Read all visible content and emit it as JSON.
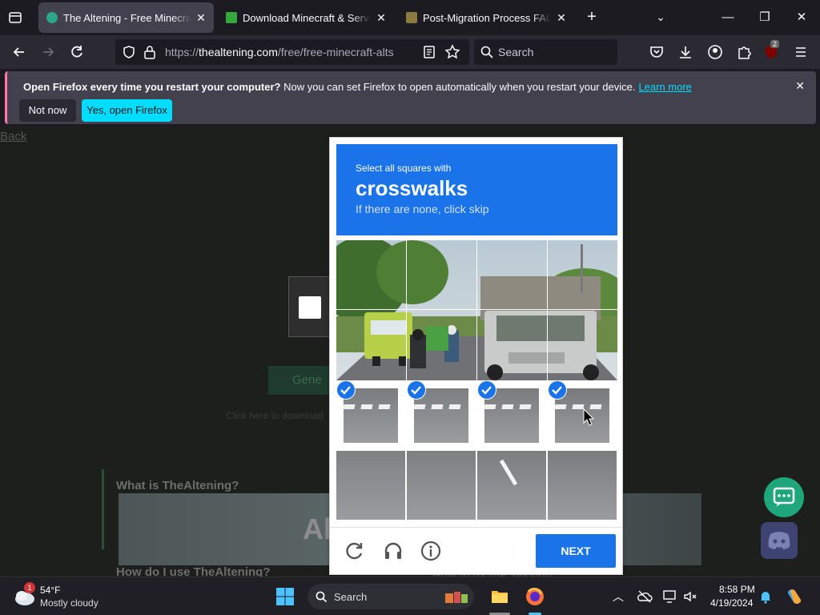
{
  "tabs": [
    {
      "title": "The Altening - Free Minecraft A",
      "favicon_color": "#2aa889",
      "active": true
    },
    {
      "title": "Download Minecraft & Server S",
      "favicon_color": "#35a83c",
      "active": false
    },
    {
      "title": "Post-Migration Process FAQ | M",
      "favicon_color": "#8a7b3f",
      "active": false
    }
  ],
  "nav": {
    "url_prefix": "https://",
    "url_domain": "thealtening.com",
    "url_path": "/free/free-minecraft-alts",
    "search_placeholder": "Search",
    "ublock_badge": "2"
  },
  "notification": {
    "bold": "Open Firefox every time you restart your computer?",
    "text": " Now you can set Firefox to open automatically when you restart your device.",
    "link": "Learn more",
    "btn_not_now": "Not now",
    "btn_yes": "Yes, open Firefox"
  },
  "page": {
    "back": "Back",
    "generate": "Gene",
    "download_text": "Click here to download",
    "faq_q1": "What is TheAltening?",
    "faq_q2": "How do I use TheAltening?",
    "faq_q3": "How to fix the Session",
    "banner_text": "Al"
  },
  "captcha": {
    "instruction": "Select all squares with",
    "target": "crosswalks",
    "hint": "If there are none, click skip",
    "next": "NEXT",
    "selected": [
      false,
      false,
      false,
      false,
      false,
      false,
      false,
      false,
      true,
      true,
      true,
      true,
      false,
      false,
      false,
      false
    ]
  },
  "taskbar": {
    "temp": "54°F",
    "weather": "Mostly cloudy",
    "weather_badge": "1",
    "search_placeholder": "Search",
    "time": "8:58 PM",
    "date": "4/19/2024"
  },
  "colors": {
    "accent": "#1a73e8",
    "firefox_cyan": "#00ddff"
  }
}
